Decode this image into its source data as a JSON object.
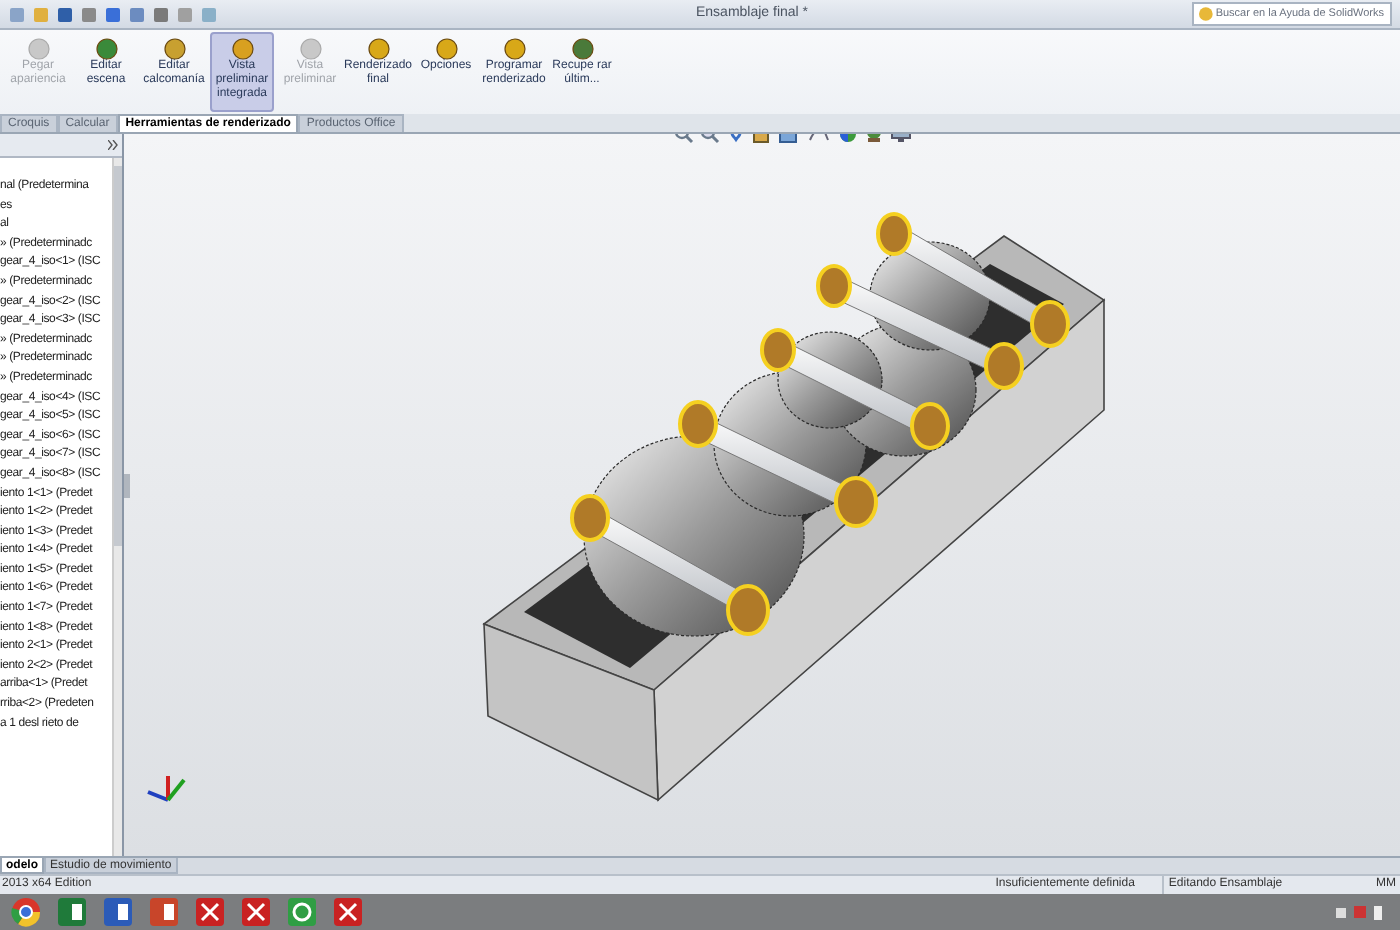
{
  "window": {
    "title": "Ensamblaje final *"
  },
  "help_search": {
    "placeholder": "Buscar en la Ayuda de SolidWorks"
  },
  "ribbon": {
    "buttons": [
      {
        "label": "Pegar apariencia",
        "disabled": true,
        "selected": false
      },
      {
        "label": "Editar escena",
        "disabled": false,
        "selected": false
      },
      {
        "label": "Editar calcomanía",
        "disabled": false,
        "selected": false
      },
      {
        "label": "Vista preliminar integrada",
        "disabled": false,
        "selected": true
      },
      {
        "label": "Vista preliminar",
        "disabled": true,
        "selected": false
      },
      {
        "label": "Renderizado final",
        "disabled": false,
        "selected": false
      },
      {
        "label": "Opciones",
        "disabled": false,
        "selected": false
      },
      {
        "label": "Programar renderizado",
        "disabled": false,
        "selected": false
      },
      {
        "label": "Recupe rar últim...",
        "disabled": false,
        "selected": false
      }
    ]
  },
  "command_tabs": [
    {
      "label": "Croquis",
      "selected": false
    },
    {
      "label": "Calcular",
      "selected": false
    },
    {
      "label": "Herramientas de renderizado",
      "selected": true
    },
    {
      "label": "Productos Office",
      "selected": false
    }
  ],
  "feature_tree": {
    "items": [
      "nal (Predetermina",
      "es",
      "al",
      "» (Predeterminadc",
      "gear_4_iso<1> (ISC",
      "» (Predeterminadc",
      "gear_4_iso<2> (ISC",
      "gear_4_iso<3> (ISC",
      "» (Predeterminadc",
      "» (Predeterminadc",
      "» (Predeterminadc",
      "gear_4_iso<4> (ISC",
      "gear_4_iso<5> (ISC",
      "gear_4_iso<6> (ISC",
      "gear_4_iso<7> (ISC",
      "gear_4_iso<8> (ISC",
      "iento 1<1> (Predet",
      "iento 1<2> (Predet",
      "iento 1<3> (Predet",
      "iento 1<4> (Predet",
      "iento 1<5> (Predet",
      "iento 1<6> (Predet",
      "iento 1<7> (Predet",
      "iento 1<8> (Predet",
      "iento 2<1> (Predet",
      "iento 2<2> (Predet",
      "arriba<1> (Predet",
      "rriba<2> (Predeten",
      "a 1 desl rieto de"
    ]
  },
  "bottom_tabs": [
    {
      "label": "odelo",
      "selected": true
    },
    {
      "label": "Estudio de movimiento",
      "selected": false
    }
  ],
  "status_bar": {
    "edition": "2013 x64 Edition",
    "definition": "Insuficientemente definida",
    "mode": "Editando Ensamblaje",
    "units": "MM"
  }
}
